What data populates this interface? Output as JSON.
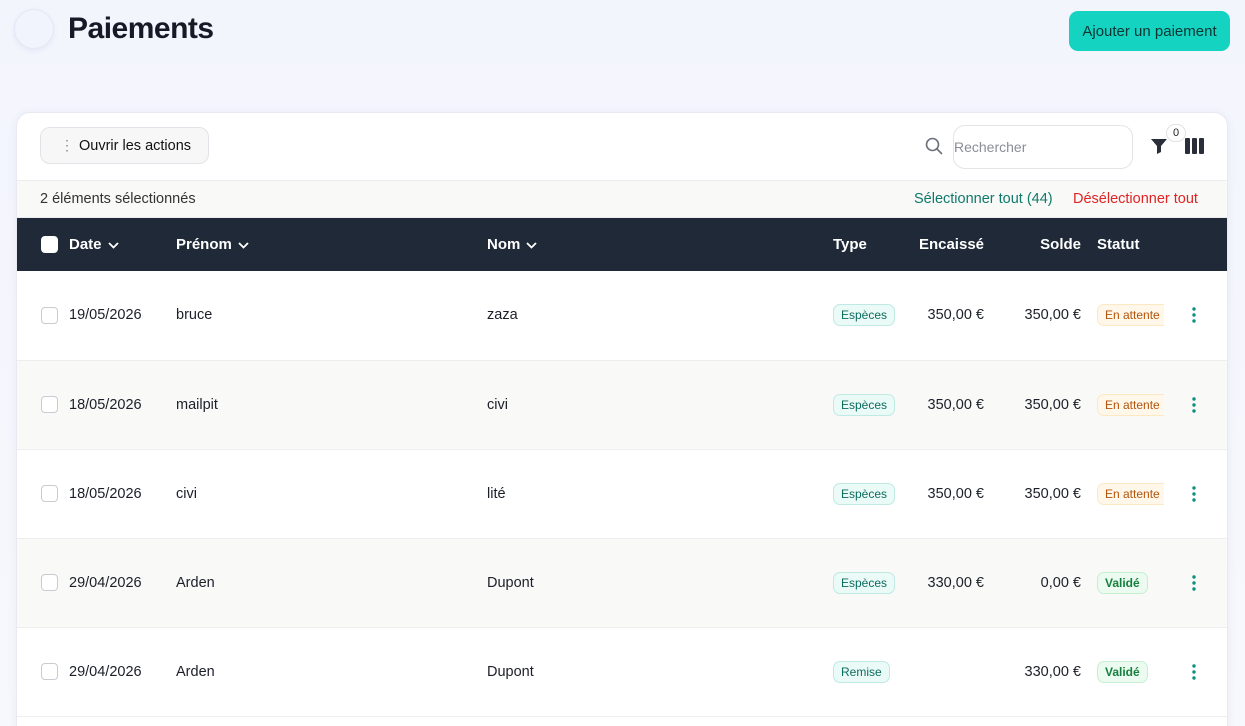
{
  "header": {
    "title": "Paiements",
    "add_button": "Ajouter un paiement"
  },
  "toolbar": {
    "actions_label": "Ouvrir les actions",
    "search_placeholder": "Rechercher",
    "filter_count": "0"
  },
  "selection": {
    "count_text": "2 éléments sélectionnés",
    "select_all": "Sélectionner tout (44)",
    "deselect_all": "Désélectionner tout"
  },
  "table": {
    "columns": {
      "date": "Date",
      "prenom": "Prénom",
      "nom": "Nom",
      "type": "Type",
      "encaisse": "Encaissé",
      "solde": "Solde",
      "statut": "Statut"
    },
    "rows": [
      {
        "date": "19/05/2026",
        "prenom": "bruce",
        "nom": "zaza",
        "type": "Espèces",
        "encaisse": "350,00 €",
        "solde": "350,00 €",
        "statut": "En attente"
      },
      {
        "date": "18/05/2026",
        "prenom": "mailpit",
        "nom": "civi",
        "type": "Espèces",
        "encaisse": "350,00 €",
        "solde": "350,00 €",
        "statut": "En attente"
      },
      {
        "date": "18/05/2026",
        "prenom": "civi",
        "nom": "lité",
        "type": "Espèces",
        "encaisse": "350,00 €",
        "solde": "350,00 €",
        "statut": "En attente"
      },
      {
        "date": "29/04/2026",
        "prenom": "Arden",
        "nom": "Dupont",
        "type": "Espèces",
        "encaisse": "330,00 €",
        "solde": "0,00 €",
        "statut": "Validé"
      },
      {
        "date": "29/04/2026",
        "prenom": "Arden",
        "nom": "Dupont",
        "type": "Remise",
        "encaisse": "",
        "solde": "330,00 €",
        "statut": "Validé"
      }
    ]
  },
  "colors": {
    "accent": "#15d3c1",
    "header_bg": "#1f2937",
    "pending": "#b45309",
    "validated": "#15803d",
    "danger": "#e02424"
  }
}
